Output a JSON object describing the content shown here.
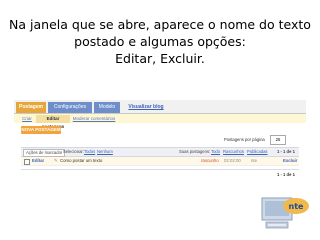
{
  "caption": {
    "line1": "Na janela que se abre, aparece o nome do texto",
    "line2": "postado e algumas opções:",
    "line3": "Editar, Excluir."
  },
  "tabs": [
    {
      "label": "Postagem"
    },
    {
      "label": "Configurações"
    },
    {
      "label": "Modelo"
    },
    {
      "label": "Visualizar blog"
    }
  ],
  "subtabs": [
    {
      "label": "Criar"
    },
    {
      "label": "Editar postagens"
    },
    {
      "label": "Moderar comentários"
    }
  ],
  "new_post_button": "NOVA POSTAGEM",
  "per_page": {
    "label": "Postagens por página",
    "value": "25"
  },
  "toolbar": {
    "actions_select": "Ações de marcador",
    "select_label": "Selecionar:",
    "select_all": "Todos",
    "select_none": "Nenhum",
    "show_label": "Suas postagens:",
    "show_all": "Todo",
    "show_drafts": "Rascunhos",
    "show_published": "Publicadas",
    "pager": "1 - 1 de 1"
  },
  "posts": [
    {
      "edit": "Editar",
      "title": "Como postar um texto",
      "status": "rascunho",
      "time": "02:02:00",
      "author": "nte",
      "delete": "Excluir"
    }
  ],
  "footer_pager": "1 - 1 de 1",
  "logo": {
    "text": "nte"
  },
  "colors": {
    "tab_active": "#e7a63a",
    "tab_blue": "#6e8ec9",
    "new_post": "#f3a33c",
    "link": "#3d63b6"
  }
}
